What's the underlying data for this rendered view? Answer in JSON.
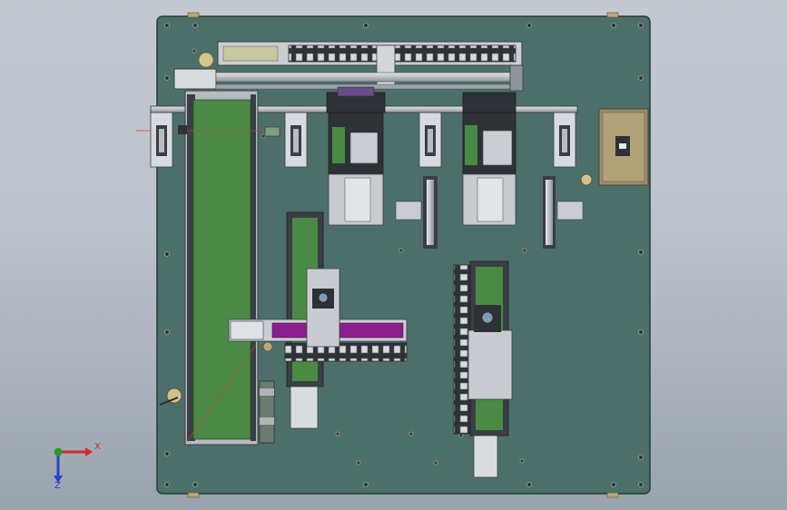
{
  "viewport": {
    "background_top": "#c4c9d1",
    "background_bottom": "#9aa3ad"
  },
  "colors": {
    "plate": "#4d6f6a",
    "plate_edge": "#263b38",
    "belt": "#4a8a44",
    "frame": "#b9bec4",
    "steel_dark": "#3a3f44",
    "purple_rail": "#8a1e8c",
    "bronze_plate": "#9b8c6c",
    "axis_x": "#d12a2a",
    "axis_y": "#2a9a2a",
    "axis_z": "#2a3fd1"
  },
  "triad": {
    "x_label": "X",
    "z_label": "Z"
  }
}
